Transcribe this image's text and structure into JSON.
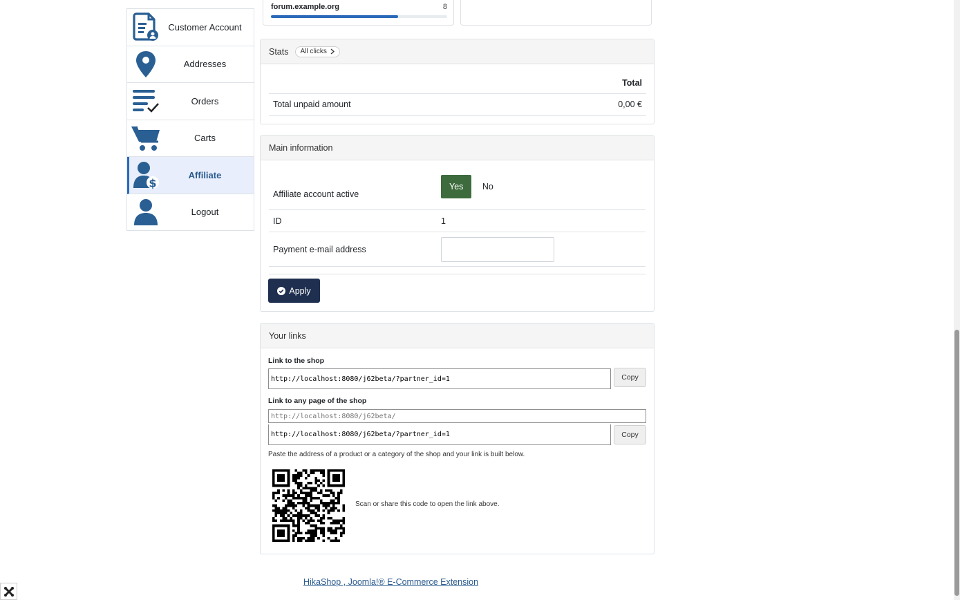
{
  "sidebar": {
    "items": [
      {
        "label": "Customer Account",
        "icon": "customer-account-icon",
        "active": false
      },
      {
        "label": "Addresses",
        "icon": "map-pin-icon",
        "active": false
      },
      {
        "label": "Orders",
        "icon": "orders-list-icon",
        "active": false
      },
      {
        "label": "Carts",
        "icon": "cart-icon",
        "active": false
      },
      {
        "label": "Affiliate",
        "icon": "affiliate-user-dollar-icon",
        "active": true
      },
      {
        "label": "Logout",
        "icon": "user-icon",
        "active": false
      }
    ]
  },
  "referrers": {
    "domain": "forum.example.org",
    "count": "8",
    "bar_fill_percent": 72
  },
  "stats": {
    "title": "Stats",
    "all_clicks_label": "All clicks",
    "column_total": "Total",
    "rows": [
      {
        "label": "Total unpaid amount",
        "value": "0,00 €"
      }
    ]
  },
  "main_info": {
    "title": "Main information",
    "active_label": "Affiliate account active",
    "yes_label": "Yes",
    "no_label": "No",
    "id_label": "ID",
    "id_value": "1",
    "email_label": "Payment e-mail address",
    "email_value": "",
    "apply_label": "Apply"
  },
  "links": {
    "title": "Your links",
    "shop_link_label": "Link to the shop",
    "shop_link_value": "http://localhost:8080/j62beta/?partner_id=1",
    "copy_label": "Copy",
    "any_page_label": "Link to any page of the shop",
    "any_page_placeholder": "http://localhost:8080/j62beta/",
    "any_page_result": "http://localhost:8080/j62beta/?partner_id=1",
    "hint": "Paste the address of a product or a category of the shop and your link is built below.",
    "qr_caption": "Scan or share this code to open the link above."
  },
  "footer": {
    "link": "HikaShop , Joomla!® E-Commerce Extension"
  },
  "colors": {
    "accent": "#2a69b8",
    "yes_green": "#3d6b3d",
    "apply_navy": "#1f2f4f",
    "icon_blue": "#2a5f93"
  }
}
